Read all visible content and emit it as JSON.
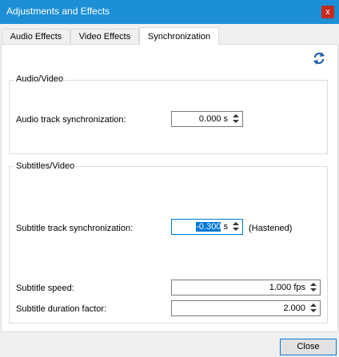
{
  "window": {
    "title": "Adjustments and Effects",
    "close_glyph": "x"
  },
  "tabs": [
    {
      "label": "Audio Effects"
    },
    {
      "label": "Video Effects"
    },
    {
      "label": "Synchronization"
    }
  ],
  "audio_video": {
    "group_title": "Audio/Video",
    "audio_sync_label": "Audio track synchronization:",
    "audio_sync_value": "0.000 s"
  },
  "subtitles_video": {
    "group_title": "Subtitles/Video",
    "subtitle_sync_label": "Subtitle track synchronization:",
    "subtitle_sync_value_selected": "-0.300",
    "subtitle_sync_unit": " s",
    "subtitle_sync_status": "(Hastened)",
    "subtitle_speed_label": "Subtitle speed:",
    "subtitle_speed_value": "1.000 fps",
    "subtitle_duration_label": "Subtitle duration factor:",
    "subtitle_duration_value": "2.000"
  },
  "footer": {
    "close_label": "Close"
  },
  "icons": {
    "reset": "refresh-icon"
  },
  "colors": {
    "titlebar": "#1d8fd6",
    "accent": "#0078d7",
    "close_red": "#c42b1c"
  }
}
